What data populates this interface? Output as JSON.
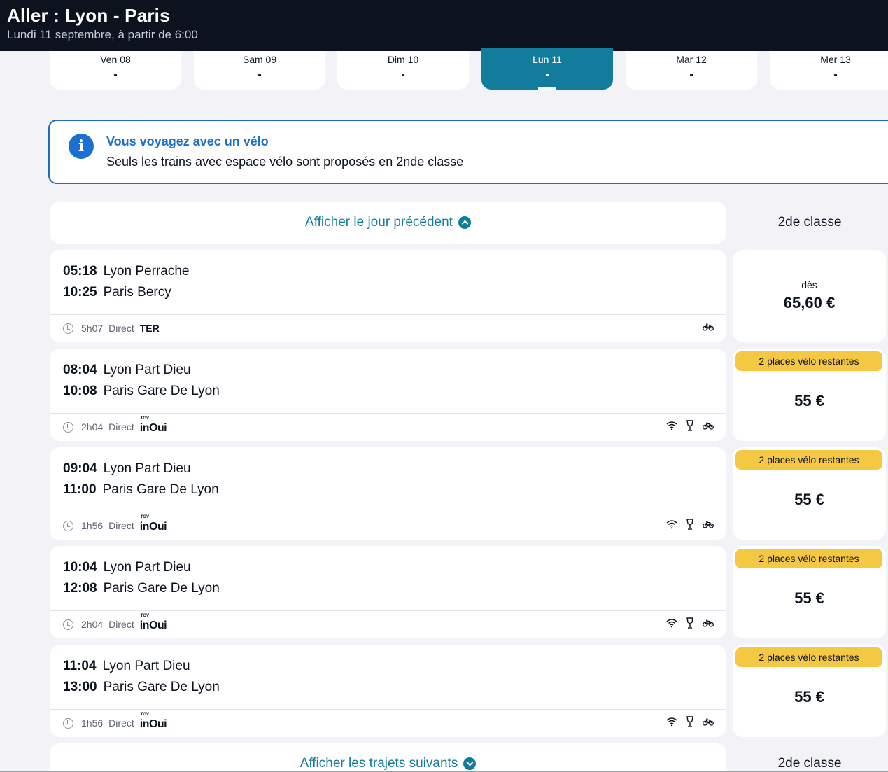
{
  "header": {
    "title": "Aller : Lyon - Paris",
    "subtitle": "Lundi 11 septembre, à partir de 6:00"
  },
  "dates": [
    {
      "label": "Ven 08",
      "price": "-"
    },
    {
      "label": "Sam 09",
      "price": "-"
    },
    {
      "label": "Dim 10",
      "price": "-"
    },
    {
      "label": "Lun 11",
      "price": "-",
      "selected": true
    },
    {
      "label": "Mar 12",
      "price": "-"
    },
    {
      "label": "Mer 13",
      "price": "-"
    }
  ],
  "info": {
    "icon": "info-icon",
    "title": "Vous voyagez avec un vélo",
    "text": "Seuls les trains avec espace vélo sont proposés en 2nde classe"
  },
  "prev_day_label": "Afficher le jour précédent",
  "next_label": "Afficher les trajets suivants",
  "class_label": "2de classe",
  "trains": [
    {
      "dep_time": "05:18",
      "dep_station": "Lyon Perrache",
      "arr_time": "10:25",
      "arr_station": "Paris Bercy",
      "duration": "5h07",
      "type": "Direct",
      "carrier": "TER",
      "amenities": [
        "bike-icon"
      ],
      "badge": "",
      "price_prefix": "dès",
      "price": "65,60 €"
    },
    {
      "dep_time": "08:04",
      "dep_station": "Lyon Part Dieu",
      "arr_time": "10:08",
      "arr_station": "Paris Gare De Lyon",
      "duration": "2h04",
      "type": "Direct",
      "carrier": "inOui",
      "carrier_sup": "TGV",
      "amenities": [
        "wifi-icon",
        "bar-icon",
        "bike-icon"
      ],
      "badge": "2 places vélo restantes",
      "price": "55 €"
    },
    {
      "dep_time": "09:04",
      "dep_station": "Lyon Part Dieu",
      "arr_time": "11:00",
      "arr_station": "Paris Gare De Lyon",
      "duration": "1h56",
      "type": "Direct",
      "carrier": "inOui",
      "carrier_sup": "TGV",
      "amenities": [
        "wifi-icon",
        "bar-icon",
        "bike-icon"
      ],
      "badge": "2 places vélo restantes",
      "price": "55 €"
    },
    {
      "dep_time": "10:04",
      "dep_station": "Lyon Part Dieu",
      "arr_time": "12:08",
      "arr_station": "Paris Gare De Lyon",
      "duration": "2h04",
      "type": "Direct",
      "carrier": "inOui",
      "carrier_sup": "TGV",
      "amenities": [
        "wifi-icon",
        "bar-icon",
        "bike-icon"
      ],
      "badge": "2 places vélo restantes",
      "price": "55 €"
    },
    {
      "dep_time": "11:04",
      "dep_station": "Lyon Part Dieu",
      "arr_time": "13:00",
      "arr_station": "Paris Gare De Lyon",
      "duration": "1h56",
      "type": "Direct",
      "carrier": "inOui",
      "carrier_sup": "TGV",
      "amenities": [
        "wifi-icon",
        "bar-icon",
        "bike-icon"
      ],
      "badge": "2 places vélo restantes",
      "price": "55 €"
    }
  ],
  "colors": {
    "header_bg": "#0c131f",
    "accent": "#127c9c",
    "info_blue": "#1a6fd0",
    "badge_yellow": "#f4c842",
    "page_bg": "#f2f2f7"
  }
}
